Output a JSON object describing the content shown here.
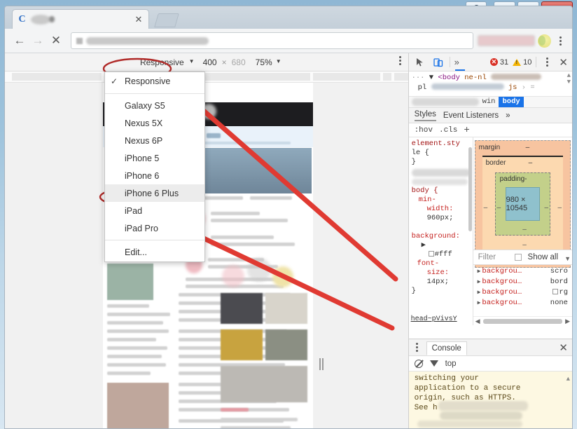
{
  "window": {
    "controls": {
      "user_label": "user-account",
      "minimize_label": "Minimize",
      "maximize_label": "Restore",
      "close_label": "✕"
    }
  },
  "browser": {
    "tab": {
      "favicon_letter": "C",
      "title": "",
      "close_label": "✕"
    },
    "new_tab_label": "",
    "nav": {
      "back": "←",
      "forward": "→",
      "stop": "✕"
    },
    "omnibox": {
      "value": "",
      "placeholder": ""
    },
    "menu_label": "⋮"
  },
  "device_toolbar": {
    "device_label": "Responsive",
    "caret": "▼",
    "width": "400",
    "separator": "×",
    "height": "680",
    "zoom": "75%",
    "zoom_caret": "▼",
    "more_label": "⋮"
  },
  "device_menu": {
    "check_mark": "✓",
    "items": [
      {
        "label": "Responsive",
        "checked": true,
        "highlighted": false
      },
      {
        "label": "Galaxy S5",
        "checked": false,
        "highlighted": false
      },
      {
        "label": "Nexus 5X",
        "checked": false,
        "highlighted": false
      },
      {
        "label": "Nexus 6P",
        "checked": false,
        "highlighted": false
      },
      {
        "label": "iPhone 5",
        "checked": false,
        "highlighted": false
      },
      {
        "label": "iPhone 6",
        "checked": false,
        "highlighted": false
      },
      {
        "label": "iPhone 6 Plus",
        "checked": false,
        "highlighted": true
      },
      {
        "label": "iPad",
        "checked": false,
        "highlighted": false
      },
      {
        "label": "iPad Pro",
        "checked": false,
        "highlighted": false
      }
    ],
    "edit_label": "Edit..."
  },
  "devtools": {
    "toolbar": {
      "inspect_icon": "inspect-element-icon",
      "device_icon": "toggle-device-toolbar-icon",
      "more_tabs": "»",
      "error_count": "31",
      "warning_count": "10",
      "error_badge": "✕",
      "warning_badge": "!",
      "menu_label": "⋮",
      "close_label": "✕"
    },
    "dom": {
      "line1_caret": "▼",
      "line1_tag": "<body",
      "line1_attr": "ne-nl",
      "line2_text": "pl",
      "line2_tail": "js",
      "line2_arrow": "›",
      "line2_eq": "=",
      "breadcrumbs": [
        {
          "label": "win",
          "selected": false
        },
        {
          "label": "body",
          "selected": true
        }
      ]
    },
    "style_tabs": [
      {
        "label": "Styles",
        "selected": true
      },
      {
        "label": "Event Listeners",
        "selected": false
      },
      {
        "label": "»",
        "selected": false
      }
    ],
    "filter_row": {
      "hov": ":hov",
      "cls": ".cls",
      "plus": "+"
    },
    "css_rules": [
      {
        "selector": "element.sty",
        "selector2": "le {",
        "close": "}"
      },
      {
        "selector": "body {",
        "props": [
          {
            "name": "min-",
            "name2": "width:",
            "value": "960px;"
          },
          {
            "name": "background:",
            "arrow": "▶",
            "value": "#fff",
            "swatch": true
          },
          {
            "name": "font-",
            "name2": "size:",
            "value": "14px;"
          }
        ],
        "close": "}"
      }
    ],
    "source_link": "head~pVivsY",
    "box_model": {
      "margin_label": "margin",
      "margin_value": "–",
      "border_label": "border",
      "border_value": "–",
      "padding_label": "padding-",
      "content_size": "980 × 10545",
      "dash": "–"
    },
    "computed": {
      "filter_placeholder": "Filter",
      "show_all_label": "Show all",
      "properties": [
        {
          "name": "backgrou…",
          "value": "scro"
        },
        {
          "name": "backgrou…",
          "value": "bord"
        },
        {
          "name": "backgrou…",
          "value": "rg",
          "swatch": true
        },
        {
          "name": "backgrou…",
          "value": "none"
        }
      ]
    }
  },
  "console": {
    "tabs": [
      {
        "label": "Console",
        "selected": true
      }
    ],
    "menu_label": "⋮",
    "close_label": "✕",
    "clear_icon": "clear-console-icon",
    "filter_icon": "filter-icon",
    "context": "top",
    "messages": [
      "switching your",
      "application to a secure",
      "origin, such as HTTPS.",
      "See h"
    ]
  },
  "annotations": {
    "circle_device_label": "Responsive",
    "circle_menu_item": "iPhone 6 Plus",
    "arrow_count": "2"
  },
  "colors": {
    "accent_blue": "#1a73e8",
    "error_red": "#d93025",
    "warning_yellow": "#f4b400",
    "annotation_red": "#b02a28",
    "console_bg": "#fdf8e2",
    "box_margin": "#f7c4a0",
    "box_border": "#fcd9b0",
    "box_padding": "#c3d08a",
    "box_content": "#8fc1cd"
  }
}
